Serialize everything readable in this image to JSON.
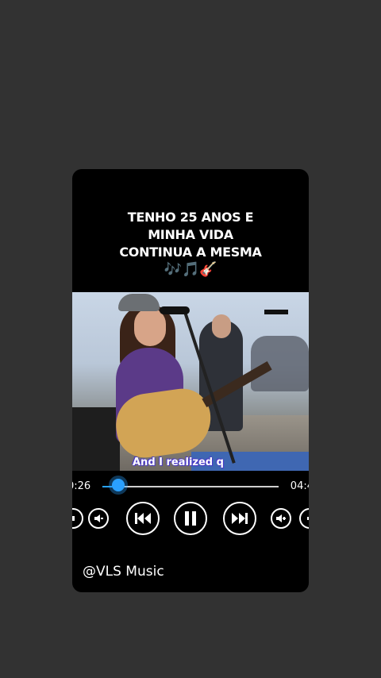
{
  "overlay": {
    "caption_lines": [
      "TENHO 25 ANOS E",
      "MINHA VIDA",
      "CONTINUA A MESMA"
    ],
    "caption_emoji": "🎶🎵🎸"
  },
  "video": {
    "subtitle": "And I realized q"
  },
  "player": {
    "time_elapsed": "0:26",
    "time_total": "04:4",
    "progress_fraction": 0.09,
    "accent_color": "#2aa0ff",
    "controls": [
      "partial-icon",
      "volume-down-icon",
      "previous-icon",
      "pause-icon",
      "next-icon",
      "volume-up-icon",
      "partial-icon"
    ]
  },
  "watermark": "@VLS Music"
}
